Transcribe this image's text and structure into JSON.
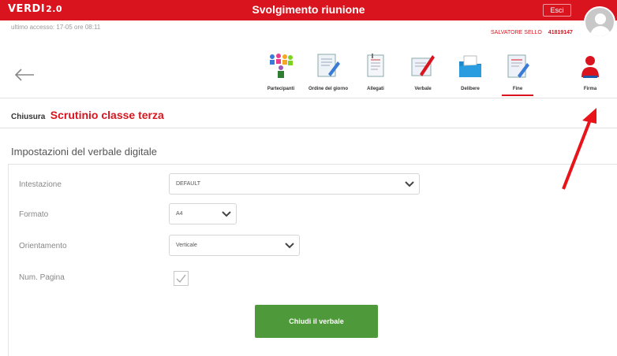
{
  "header": {
    "logo_main": "VE",
    "logo_rest": "RDI",
    "logo_version": "2.0",
    "title": "Svolgimento riunione",
    "exit_label": "Esci"
  },
  "info": {
    "last_access": "ultimo accesso: 17-05 ore 08:11",
    "user_name": "SALVATORE SELLO",
    "user_code": "41819147"
  },
  "toolbar": {
    "items": [
      {
        "label": "Partecipanti",
        "icon": "people-icon"
      },
      {
        "label": "Ordine del giorno",
        "icon": "agenda-icon"
      },
      {
        "label": "Allegati",
        "icon": "attachment-icon"
      },
      {
        "label": "Verbale",
        "icon": "minutes-icon"
      },
      {
        "label": "Delibere",
        "icon": "folder-icon"
      },
      {
        "label": "Fine",
        "icon": "end-icon"
      },
      {
        "label": "Firma",
        "icon": "sign-icon"
      }
    ],
    "active": "Fine"
  },
  "breadcrumb": {
    "prefix": "Chiusura",
    "title": "Scrutinio classe terza"
  },
  "section": {
    "title": "Impostazioni del verbale digitale"
  },
  "form": {
    "intestazione": {
      "label": "Intestazione",
      "value": "DEFAULT"
    },
    "formato": {
      "label": "Formato",
      "value": "A4"
    },
    "orientamento": {
      "label": "Orientamento",
      "value": "Verticale"
    },
    "num_pagina": {
      "label": "Num. Pagina",
      "checked": true
    }
  },
  "actions": {
    "close_label": "Chiudi il verbale"
  },
  "colors": {
    "brand_red": "#d9141e",
    "button_green": "#4e9a3a"
  }
}
